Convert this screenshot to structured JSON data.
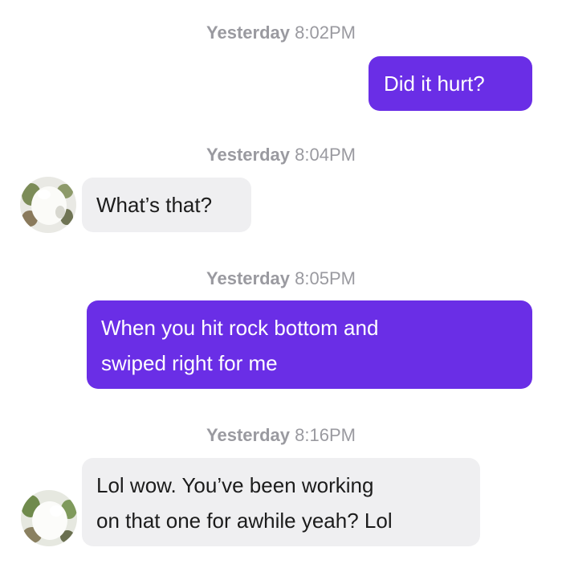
{
  "conversation": {
    "messages": [
      {
        "time_day": "Yesterday",
        "time_clock": "8:02PM",
        "direction": "sent",
        "text": "Did it hurt?"
      },
      {
        "time_day": "Yesterday",
        "time_clock": "8:04PM",
        "direction": "received",
        "text": "What’s that?"
      },
      {
        "time_day": "Yesterday",
        "time_clock": "8:05PM",
        "direction": "sent",
        "text_lines": [
          "When you hit rock bottom and",
          "swiped right for me"
        ]
      },
      {
        "time_day": "Yesterday",
        "time_clock": "8:16PM",
        "direction": "received",
        "text_lines": [
          "Lol wow. You’ve been working",
          "on that one for awhile yeah? Lol"
        ]
      }
    ]
  },
  "colors": {
    "sent_bubble": "#6a2ee6",
    "received_bubble": "#efeff1",
    "timestamp": "#9a9aa0"
  },
  "icons": {
    "contact_avatar": "blurred-profile-photo"
  }
}
